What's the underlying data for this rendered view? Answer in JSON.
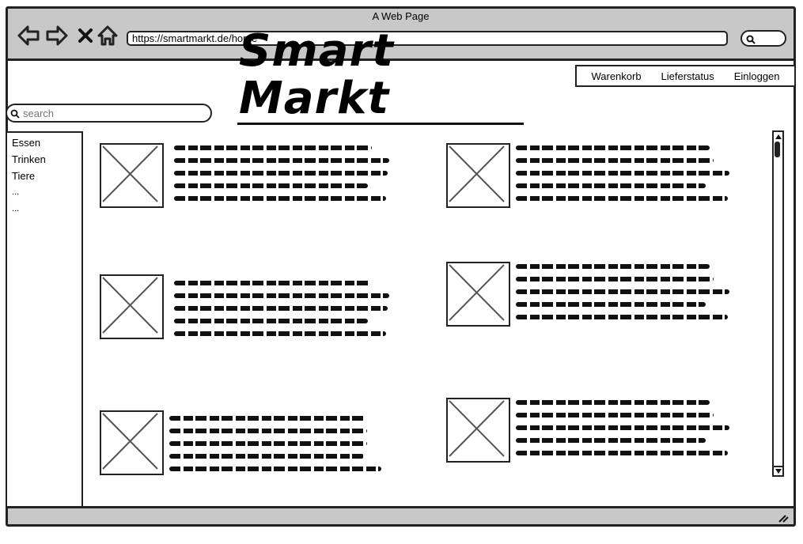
{
  "browser": {
    "window_title": "A Web Page",
    "url": "https://smartmarkt.de/home"
  },
  "header": {
    "menu": [
      "Warenkorb",
      "Lieferstatus",
      "Einloggen"
    ],
    "logo": "Smart Markt"
  },
  "search": {
    "placeholder": "search"
  },
  "sidebar": {
    "items": [
      "Essen",
      "Trinken",
      "Tiere",
      "...",
      "..."
    ]
  },
  "products": [
    {
      "image": "placeholder-image",
      "text_lines": 5
    },
    {
      "image": "placeholder-image",
      "text_lines": 5
    },
    {
      "image": "placeholder-image",
      "text_lines": 5
    },
    {
      "image": "placeholder-image",
      "text_lines": 5
    },
    {
      "image": "placeholder-image",
      "text_lines": 5
    },
    {
      "image": "placeholder-image",
      "text_lines": 5
    }
  ],
  "colors": {
    "chrome": "#c8c8c8",
    "border": "#222222"
  }
}
